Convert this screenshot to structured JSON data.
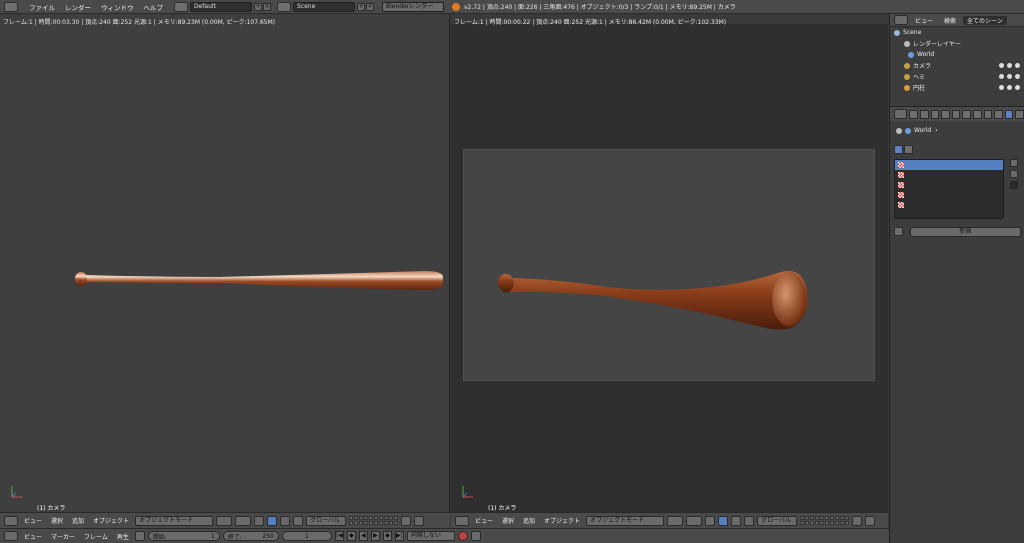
{
  "topbar": {
    "menus": [
      "ファイル",
      "レンダー",
      "ウィンドウ",
      "ヘルプ"
    ],
    "layout": "Default",
    "scene": "Scene",
    "engine": "Blenderレンダー",
    "stats": "v2.72 | 頂点:240 | 面:226 | 三角面:476 | オブジェクト:0/3 | ランプ:0/1 | メモリ:89.25M | カメラ"
  },
  "viewport_left": {
    "header": "フレーム:1 | 時間:00:03.30 | 頂点:240 面:252 光源:1 | メモリ:89.23M (0.00M,  ピーク:107.65M)",
    "label": "(1) カメラ"
  },
  "viewport_right": {
    "header": "フレーム:1 | 時間:00:00.22 | 頂点:240 面:252 光源:1 | メモリ:86.42M (0.00M,  ピーク:102.33M)",
    "label": "(1) カメラ"
  },
  "view_header": {
    "menus": [
      "ビュー",
      "選択",
      "追加",
      "オブジェクト"
    ],
    "mode": "オブジェクトモード",
    "orientation": "グローバル"
  },
  "timeline": {
    "menus": [
      "ビュー",
      "マーカー",
      "フレーム",
      "再生"
    ],
    "start_label": "開始:",
    "start_value": "1",
    "end_label": "終了:",
    "end_value": "250",
    "current": "1",
    "sync": "同期しない"
  },
  "outliner": {
    "tabs": [
      "ビュー",
      "検索",
      "全てのシーン"
    ],
    "items": [
      {
        "label": "Scene"
      },
      {
        "label": "レンダーレイヤー"
      },
      {
        "label": "World"
      },
      {
        "label": "カメラ"
      },
      {
        "label": "ヘミ"
      },
      {
        "label": "円柱"
      }
    ]
  },
  "properties": {
    "breadcrumb": "World",
    "new_button": "新規"
  },
  "colors": {
    "bat_wood": "#8a3f1c",
    "selection_blue": "#5680c2"
  }
}
